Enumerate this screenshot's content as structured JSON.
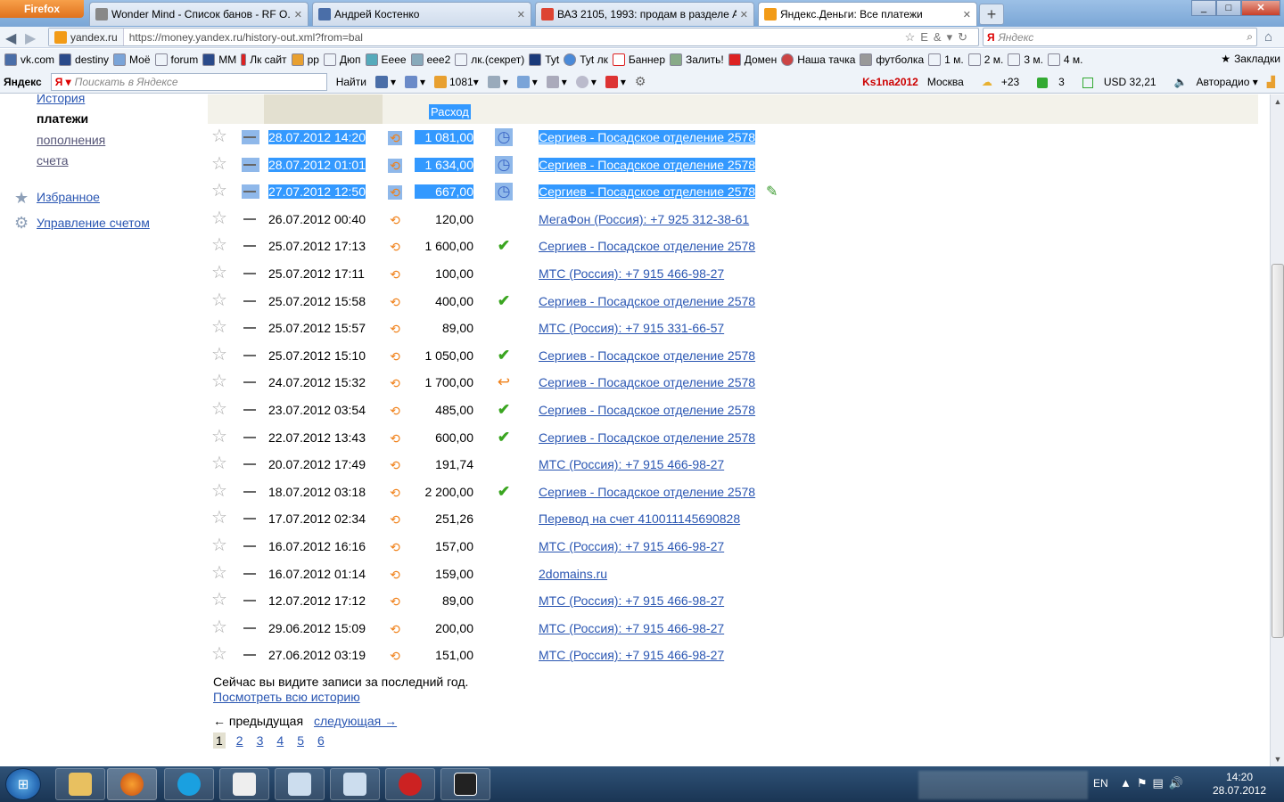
{
  "browser": {
    "menu_label": "Firefox",
    "tabs": [
      {
        "title": "Wonder Mind - Список банов - RF О...",
        "active": false
      },
      {
        "title": "Андрей Костенко",
        "active": false
      },
      {
        "title": "ВАЗ 2105, 1993: продам в разделе А...",
        "active": false
      },
      {
        "title": "Яндекс.Деньги: Все платежи",
        "active": true
      }
    ],
    "new_tab_label": "+",
    "site_identity": "yandex.ru",
    "url": "https://money.yandex.ru/history-out.xml?from=bal",
    "search_placeholder": "Яндекс",
    "search_engine_label": "Я"
  },
  "bookmarks": {
    "items": [
      "vk.com",
      "destiny",
      "Моё",
      "forum",
      "MM",
      "Лк сайт",
      "pp",
      "Дюп",
      "Eeee",
      "eee2",
      "лк.(секрет)",
      "Tyt",
      "Tyt лк",
      "Баннер",
      "Залить!",
      "Домен",
      "Наша тачка",
      "футболка",
      "1 м.",
      "2 м.",
      "3 м.",
      "4 м."
    ],
    "folder_label": "Закладки"
  },
  "yandex_bar": {
    "logo": "Яндекс",
    "search_placeholder": "Поискать в Яндексе",
    "find_label": "Найти",
    "mail_count": "1081",
    "user": "Ks1na2012",
    "city": "Москва",
    "temperature": "+23",
    "counter": "3",
    "currency": "USD 32,21",
    "radio": "Авторадио"
  },
  "sidebar": {
    "history_link": "История",
    "current": "платежи",
    "links": [
      "пополнения",
      "счета"
    ],
    "favorites": "Избранное",
    "account": "Управление счетом"
  },
  "table": {
    "expense_header": "Расход",
    "rows": [
      {
        "date": "28.07.2012 14:20",
        "amount": "1 081,00",
        "status": "clock",
        "recipient": "Сергиев - Посадское отделение 2578",
        "selected": true
      },
      {
        "date": "28.07.2012 01:01",
        "amount": "1 634,00",
        "status": "clock",
        "recipient": "Сергиев - Посадское отделение 2578",
        "selected": true
      },
      {
        "date": "27.07.2012 12:50",
        "amount": "667,00",
        "status": "clock",
        "recipient": "Сергиев - Посадское отделение 2578",
        "selected": true
      },
      {
        "date": "26.07.2012 00:40",
        "amount": "120,00",
        "status": "",
        "recipient": "МегаФон (Россия): +7 925 312-38-61",
        "selected": false
      },
      {
        "date": "25.07.2012 17:13",
        "amount": "1 600,00",
        "status": "ok",
        "recipient": "Сергиев - Посадское отделение 2578",
        "selected": false
      },
      {
        "date": "25.07.2012 17:11",
        "amount": "100,00",
        "status": "",
        "recipient": "МТС (Россия): +7 915 466-98-27",
        "selected": false
      },
      {
        "date": "25.07.2012 15:58",
        "amount": "400,00",
        "status": "ok",
        "recipient": "Сергиев - Посадское отделение 2578",
        "selected": false
      },
      {
        "date": "25.07.2012 15:57",
        "amount": "89,00",
        "status": "",
        "recipient": "МТС (Россия): +7 915 331-66-57",
        "selected": false
      },
      {
        "date": "25.07.2012 15:10",
        "amount": "1 050,00",
        "status": "ok",
        "recipient": "Сергиев - Посадское отделение 2578",
        "selected": false
      },
      {
        "date": "24.07.2012 15:32",
        "amount": "1 700,00",
        "status": "return",
        "recipient": "Сергиев - Посадское отделение 2578",
        "selected": false
      },
      {
        "date": "23.07.2012 03:54",
        "amount": "485,00",
        "status": "ok",
        "recipient": "Сергиев - Посадское отделение 2578",
        "selected": false
      },
      {
        "date": "22.07.2012 13:43",
        "amount": "600,00",
        "status": "ok",
        "recipient": "Сергиев - Посадское отделение 2578",
        "selected": false
      },
      {
        "date": "20.07.2012 17:49",
        "amount": "191,74",
        "status": "",
        "recipient": "МТС (Россия): +7 915 466-98-27",
        "selected": false
      },
      {
        "date": "18.07.2012 03:18",
        "amount": "2 200,00",
        "status": "ok",
        "recipient": "Сергиев - Посадское отделение 2578",
        "selected": false
      },
      {
        "date": "17.07.2012 02:34",
        "amount": "251,26",
        "status": "",
        "recipient": "Перевод на счет 410011145690828",
        "selected": false
      },
      {
        "date": "16.07.2012 16:16",
        "amount": "157,00",
        "status": "",
        "recipient": "МТС (Россия): +7 915 466-98-27",
        "selected": false
      },
      {
        "date": "16.07.2012 01:14",
        "amount": "159,00",
        "status": "",
        "recipient": "2domains.ru",
        "selected": false
      },
      {
        "date": "12.07.2012 17:12",
        "amount": "89,00",
        "status": "",
        "recipient": "МТС (Россия): +7 915 466-98-27",
        "selected": false
      },
      {
        "date": "29.06.2012 15:09",
        "amount": "200,00",
        "status": "",
        "recipient": "МТС (Россия): +7 915 466-98-27",
        "selected": false
      },
      {
        "date": "27.06.2012 03:19",
        "amount": "151,00",
        "status": "",
        "recipient": "МТС (Россия): +7 915 466-98-27",
        "selected": false
      }
    ]
  },
  "footer": {
    "note": "Сейчас вы видите записи за последний год.",
    "history_link": "Посмотреть всю историю",
    "prev": "← предыдущая",
    "next": "следующая →",
    "pages": [
      "1",
      "2",
      "3",
      "4",
      "5",
      "6"
    ],
    "current_page": "1"
  },
  "taskbar": {
    "lang": "EN",
    "time": "14:20",
    "date": "28.07.2012"
  },
  "colors": {
    "link": "#2a56b2",
    "selection": "#3399ff",
    "status_ok": "#3aa520",
    "arrow": "#f08018"
  }
}
